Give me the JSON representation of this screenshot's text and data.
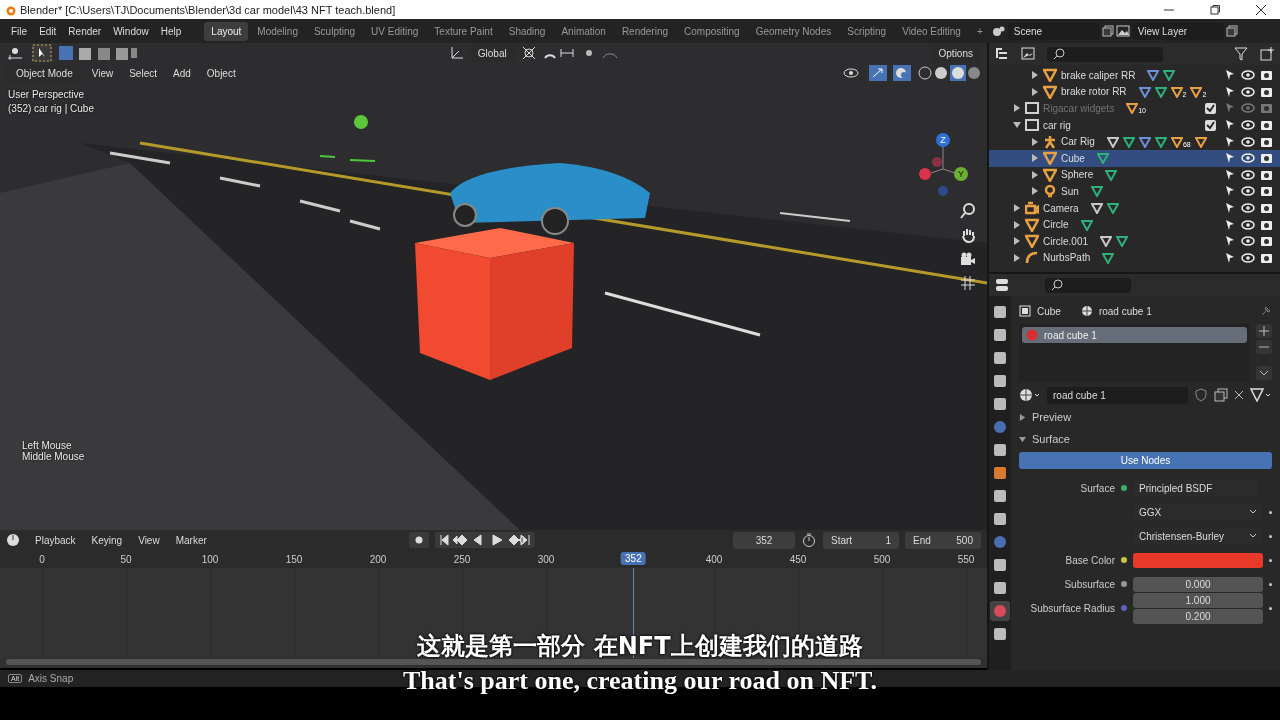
{
  "window": {
    "title": "Blender* [C:\\Users\\TJ\\Documents\\Blender\\3d car model\\43 NFT teach.blend]"
  },
  "menu": [
    "File",
    "Edit",
    "Render",
    "Window",
    "Help"
  ],
  "workspaces": [
    {
      "label": "Layout",
      "selected": true
    },
    {
      "label": "Modeling",
      "selected": false
    },
    {
      "label": "Sculpting",
      "selected": false
    },
    {
      "label": "UV Editing",
      "selected": false
    },
    {
      "label": "Texture Paint",
      "selected": false
    },
    {
      "label": "Shading",
      "selected": false
    },
    {
      "label": "Animation",
      "selected": false
    },
    {
      "label": "Rendering",
      "selected": false
    },
    {
      "label": "Compositing",
      "selected": false
    },
    {
      "label": "Geometry Nodes",
      "selected": false
    },
    {
      "label": "Scripting",
      "selected": false
    },
    {
      "label": "Video Editing",
      "selected": false
    }
  ],
  "add_workspace": "+",
  "scene": "Scene",
  "view_layer": "View Layer",
  "viewport": {
    "orientation": "Global",
    "options": "Options",
    "mode": "Object Mode",
    "menus": [
      "View",
      "Select",
      "Add",
      "Object"
    ],
    "info": [
      "User Perspective",
      "(352) car rig | Cube"
    ],
    "hints": [
      "Left Mouse",
      "Middle Mouse"
    ],
    "gizmo_labels": [
      "Z",
      "Y"
    ]
  },
  "outliner": {
    "rows": [
      {
        "children": [
          {
            "name": "brake caliper RR",
            "kind": "mesh",
            "selected": false,
            "disabled": false,
            "expanded": false,
            "data_icons": [
              {
                "kind": "wrench"
              },
              {
                "kind": "mesh-data"
              }
            ]
          },
          {
            "name": "brake rotor RR",
            "kind": "mesh",
            "selected": false,
            "disabled": false,
            "expanded": false,
            "data_icons": [
              {
                "kind": "wrench"
              },
              {
                "kind": "mesh-data"
              },
              {
                "kind": "mesh",
                "count": "2"
              },
              {
                "kind": "curve",
                "count": "2"
              }
            ]
          }
        ]
      },
      {
        "name": "Rigacar widgets",
        "kind": "collection",
        "selected": false,
        "disabled": true,
        "expanded": false,
        "checked": true,
        "data_icons": [
          {
            "kind": "mesh",
            "count": "10"
          }
        ]
      },
      {
        "name": "car rig",
        "kind": "collection",
        "selected": false,
        "disabled": false,
        "expanded": true,
        "checked": true,
        "data_icons": [],
        "children": [
          {
            "name": "Car Rig",
            "kind": "armature",
            "selected": false,
            "disabled": false,
            "expanded": false,
            "data_icons": [
              {
                "kind": "constraint"
              },
              {
                "kind": "armature-data"
              },
              {
                "kind": "wrench"
              },
              {
                "kind": "armature-data"
              },
              {
                "kind": "mesh",
                "count": "68"
              },
              {
                "kind": "curve"
              }
            ]
          },
          {
            "name": "Cube",
            "kind": "mesh",
            "selected": true,
            "disabled": false,
            "expanded": false,
            "data_icons": [
              {
                "kind": "mesh-data"
              }
            ]
          },
          {
            "name": "Sphere",
            "kind": "mesh",
            "selected": false,
            "disabled": false,
            "expanded": false,
            "data_icons": [
              {
                "kind": "mesh-data"
              }
            ]
          },
          {
            "name": "Sun",
            "kind": "light",
            "selected": false,
            "disabled": false,
            "expanded": false,
            "data_icons": [
              {
                "kind": "light-data"
              }
            ]
          }
        ]
      },
      {
        "name": "Camera",
        "kind": "camera",
        "selected": false,
        "disabled": false,
        "expanded": false,
        "data_icons": [
          {
            "kind": "constraint"
          },
          {
            "kind": "camera-data"
          }
        ]
      },
      {
        "name": "Circle",
        "kind": "mesh",
        "selected": false,
        "disabled": false,
        "expanded": false,
        "data_icons": [
          {
            "kind": "mesh-data"
          }
        ]
      },
      {
        "name": "Circle.001",
        "kind": "mesh",
        "selected": false,
        "disabled": false,
        "expanded": false,
        "data_icons": [
          {
            "kind": "constraint"
          },
          {
            "kind": "mesh-data"
          }
        ]
      },
      {
        "name": "NurbsPath",
        "kind": "curve",
        "selected": false,
        "disabled": false,
        "expanded": false,
        "data_icons": [
          {
            "kind": "curve-data"
          }
        ]
      }
    ]
  },
  "properties": {
    "tabs": [
      {
        "kind": "tool",
        "selected": false
      },
      {
        "kind": "render",
        "selected": false
      },
      {
        "kind": "output",
        "selected": false
      },
      {
        "kind": "view-layer",
        "selected": false
      },
      {
        "kind": "scene",
        "selected": false
      },
      {
        "kind": "world",
        "selected": false
      },
      {
        "kind": "collection",
        "selected": false
      },
      {
        "kind": "object",
        "selected": false
      },
      {
        "kind": "modifier",
        "selected": false
      },
      {
        "kind": "particles",
        "selected": false
      },
      {
        "kind": "physics",
        "selected": false
      },
      {
        "kind": "constraints",
        "selected": false
      },
      {
        "kind": "data",
        "selected": false
      },
      {
        "kind": "material",
        "selected": true
      },
      {
        "kind": "texture",
        "selected": false
      }
    ],
    "object": "Cube",
    "material": "road cube 1",
    "slots": [
      {
        "name": "road cube 1",
        "selected": true
      }
    ],
    "material_field": "road cube 1",
    "panels": [
      {
        "title": "Preview",
        "expanded": false
      },
      {
        "title": "Surface",
        "expanded": true
      }
    ],
    "use_nodes": {
      "label": "Use Nodes",
      "on": true
    },
    "fields": [
      {
        "kind": "link",
        "label": "Surface",
        "value": "Principled BSDF"
      },
      {
        "kind": "dropdown",
        "value": "GGX"
      },
      {
        "kind": "dropdown",
        "value": "Christensen-Burley"
      },
      {
        "kind": "color",
        "label": "Base Color",
        "color": "#e8392b"
      },
      {
        "kind": "number",
        "label": "Subsurface",
        "value": "0.000"
      },
      {
        "kind": "vector",
        "label": "Subsurface Radius",
        "values": [
          "1.000",
          "0.200"
        ]
      }
    ]
  },
  "timeline": {
    "menus": [
      "Playback",
      "Keying",
      "View",
      "Marker"
    ],
    "frame": "352",
    "start_label": "Start",
    "start": "1",
    "end_label": "End",
    "end": "500",
    "ticks": [
      "0",
      "50",
      "100",
      "150",
      "200",
      "250",
      "300",
      "400",
      "450",
      "500",
      "550"
    ],
    "current": "352"
  },
  "status_bar": {
    "key": "Alt",
    "text": "Axis Snap"
  },
  "subtitles": [
    "这就是第一部分 在NFT上创建我们的道路",
    "That's part one, creating our road on NFT."
  ]
}
